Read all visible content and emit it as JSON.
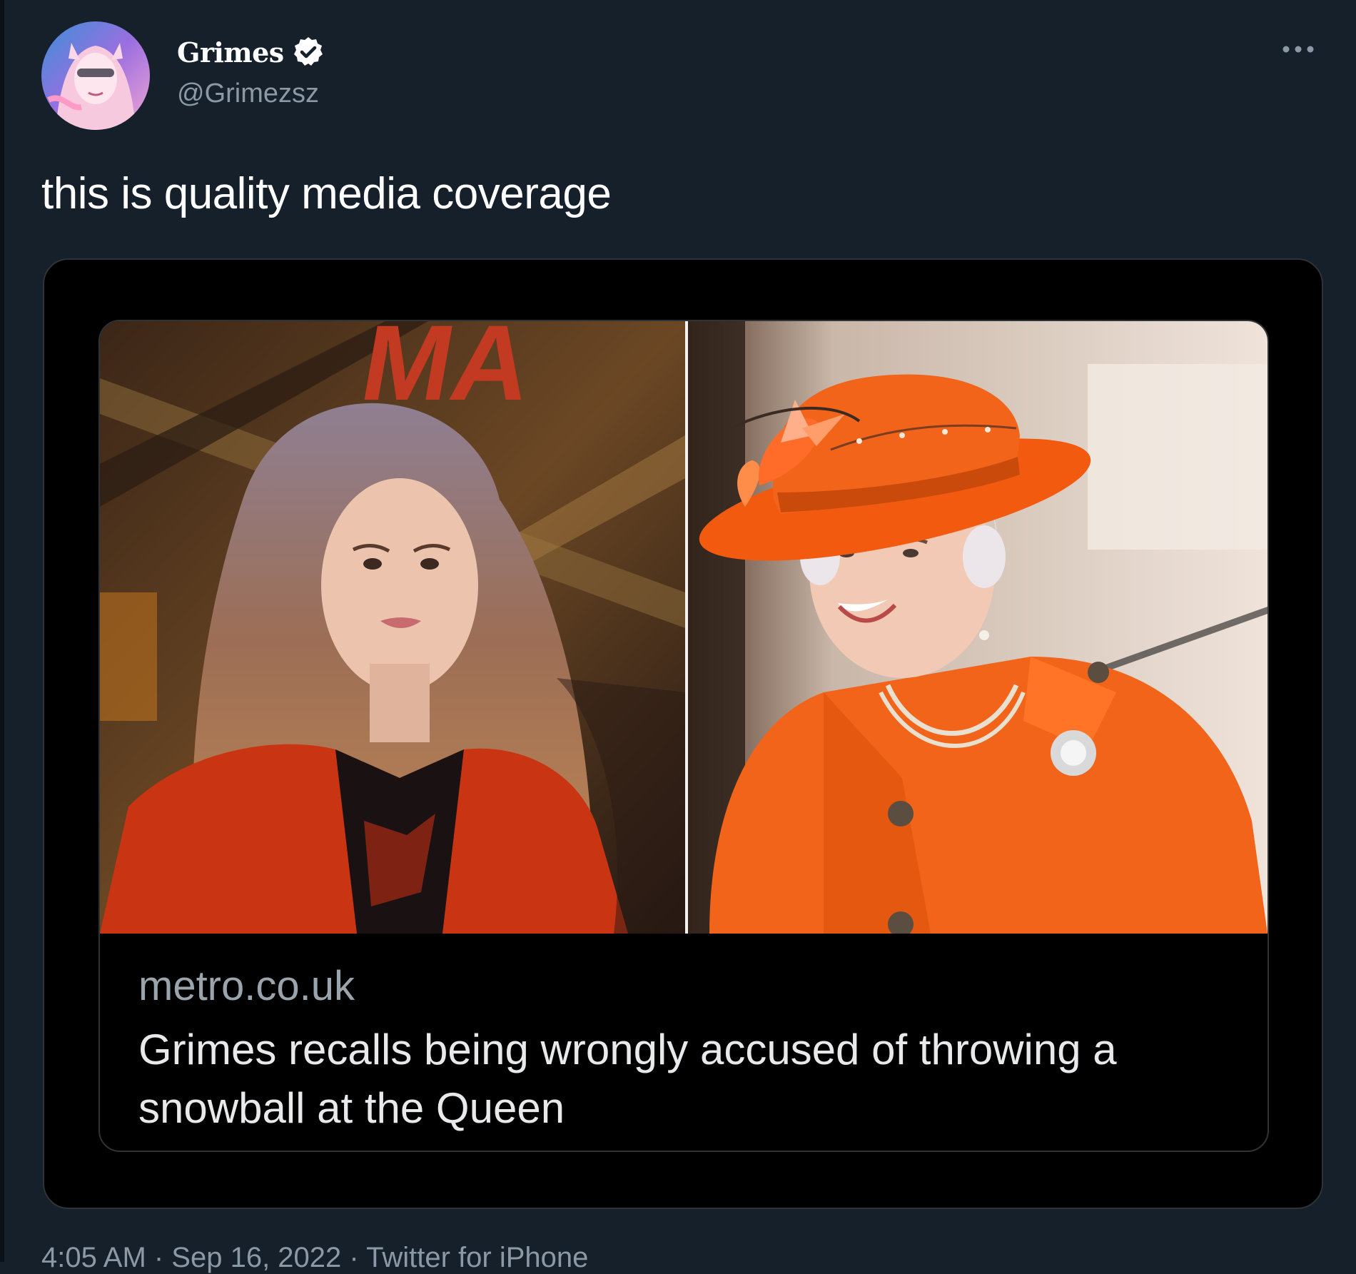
{
  "tweet": {
    "author": {
      "display_name": "Grimes",
      "handle": "@Grimezsz",
      "verified": true
    },
    "text": "this is quality media coverage",
    "more_icon": "more-horizontal-icon",
    "timestamp": "4:05 AM · Sep 16, 2022 · Twitter for iPhone"
  },
  "card": {
    "domain": "metro.co.uk",
    "title": "Grimes recalls being wrongly accused of throwing a snowball at the Queen",
    "backdrop_text": "MA"
  },
  "colors": {
    "background": "#15202b",
    "card_background": "#000000",
    "text_primary": "#ffffff",
    "text_secondary": "#8b98a5",
    "accent_orange": "#f25a10"
  }
}
